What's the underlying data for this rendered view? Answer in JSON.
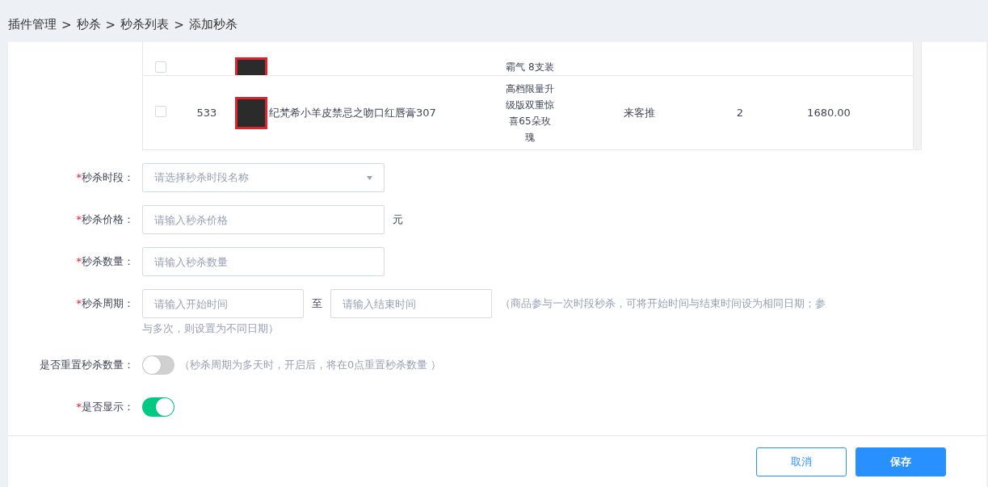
{
  "breadcrumb": [
    "插件管理",
    "秒杀",
    "秒杀列表",
    "添加秒杀"
  ],
  "breadcrumb_separator": ">",
  "required_mark": "*",
  "table": {
    "rows": [
      {
        "partial": true,
        "checked": false,
        "id": "",
        "name": "",
        "spec": "霸气 8支装",
        "source": "",
        "stock": "",
        "price": ""
      },
      {
        "partial": false,
        "checked": false,
        "id": "533",
        "name": "纪梵希小羊皮禁忌之吻口红唇膏307",
        "spec": "高档限量升级版双重惊喜65朵玫瑰",
        "source": "来客推",
        "stock": "2",
        "price": "1680.00"
      }
    ]
  },
  "form": [
    {
      "kind": "select",
      "required": true,
      "label": "秒杀时段：",
      "placeholder": "请选择秒杀时段名称"
    },
    {
      "kind": "input",
      "required": true,
      "label": "秒杀价格：",
      "placeholder": "请输入秒杀价格",
      "suffix": "元"
    },
    {
      "kind": "input",
      "required": true,
      "label": "秒杀数量：",
      "placeholder": "请输入秒杀数量"
    },
    {
      "kind": "range",
      "required": true,
      "label": "秒杀周期：",
      "placeholder": "请输入开始时间",
      "separator": "至",
      "placeholder_end": "请输入结束时间",
      "hint_lines": [
        "（商品参与一次时段秒杀，可将开始时间与结束时间设为相同日期；参",
        "与多次，则设置为不同日期）"
      ]
    },
    {
      "kind": "toggle",
      "required": false,
      "label": "是否重置秒杀数量：",
      "on": false,
      "hint": "（秒杀周期为多天时，开启后，将在0点重置秒杀数量 ）"
    },
    {
      "kind": "toggle",
      "required": true,
      "label": "是否显示：",
      "on": true
    }
  ],
  "buttons": [
    {
      "kind": "secondary",
      "label": "取消"
    },
    {
      "kind": "primary",
      "label": "保存"
    }
  ]
}
